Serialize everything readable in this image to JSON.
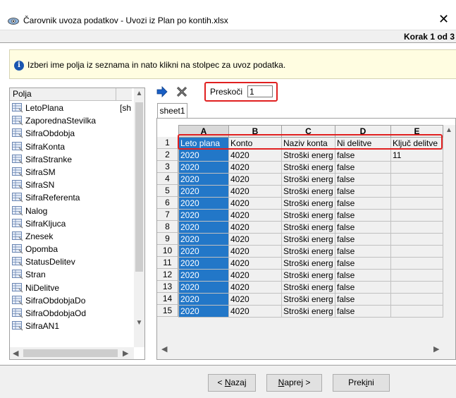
{
  "window": {
    "title": "Čarovnik uvoza podatkov - Uvozi iz Plan po kontih.xlsx",
    "close_glyph": "✕",
    "step_label": "Korak 1 od 3"
  },
  "info": {
    "icon": "info-icon",
    "text": "Izberi ime polja iz seznama in nato klikni na stolpec za uvoz podatka."
  },
  "fields": {
    "header": "Polja",
    "items": [
      {
        "label": "LetoPlana",
        "extra": "[sh"
      },
      {
        "label": "ZaporednaStevilka",
        "extra": ""
      },
      {
        "label": "SifraObdobja",
        "extra": ""
      },
      {
        "label": "SifraKonta",
        "extra": ""
      },
      {
        "label": "SifraStranke",
        "extra": ""
      },
      {
        "label": "SifraSM",
        "extra": ""
      },
      {
        "label": "SifraSN",
        "extra": ""
      },
      {
        "label": "SifraReferenta",
        "extra": ""
      },
      {
        "label": "Nalog",
        "extra": ""
      },
      {
        "label": "SifraKljuca",
        "extra": ""
      },
      {
        "label": "Znesek",
        "extra": ""
      },
      {
        "label": "Opomba",
        "extra": ""
      },
      {
        "label": "StatusDelitev",
        "extra": ""
      },
      {
        "label": "Stran",
        "extra": ""
      },
      {
        "label": "NiDelitve",
        "extra": ""
      },
      {
        "label": "SifraObdobjaDo",
        "extra": ""
      },
      {
        "label": "SifraObdobjaOd",
        "extra": ""
      },
      {
        "label": "SifraAN1",
        "extra": ""
      }
    ]
  },
  "toolbar": {
    "skip_label": "Preskoči",
    "skip_value": "1"
  },
  "sheet": {
    "tab": "sheet1",
    "columns": [
      "A",
      "B",
      "C",
      "D",
      "E"
    ],
    "rows": [
      {
        "n": "1",
        "cells": [
          "Leto plana",
          "Konto",
          "Naziv konta",
          "Ni delitve",
          "Ključ delitve"
        ]
      },
      {
        "n": "2",
        "cells": [
          "2020",
          "4020",
          "Stroški energ",
          "false",
          "11"
        ]
      },
      {
        "n": "3",
        "cells": [
          "2020",
          "4020",
          "Stroški energ",
          "false",
          ""
        ]
      },
      {
        "n": "4",
        "cells": [
          "2020",
          "4020",
          "Stroški energ",
          "false",
          ""
        ]
      },
      {
        "n": "5",
        "cells": [
          "2020",
          "4020",
          "Stroški energ",
          "false",
          ""
        ]
      },
      {
        "n": "6",
        "cells": [
          "2020",
          "4020",
          "Stroški energ",
          "false",
          ""
        ]
      },
      {
        "n": "7",
        "cells": [
          "2020",
          "4020",
          "Stroški energ",
          "false",
          ""
        ]
      },
      {
        "n": "8",
        "cells": [
          "2020",
          "4020",
          "Stroški energ",
          "false",
          ""
        ]
      },
      {
        "n": "9",
        "cells": [
          "2020",
          "4020",
          "Stroški energ",
          "false",
          ""
        ]
      },
      {
        "n": "10",
        "cells": [
          "2020",
          "4020",
          "Stroški energ",
          "false",
          ""
        ]
      },
      {
        "n": "11",
        "cells": [
          "2020",
          "4020",
          "Stroški energ",
          "false",
          ""
        ]
      },
      {
        "n": "12",
        "cells": [
          "2020",
          "4020",
          "Stroški energ",
          "false",
          ""
        ]
      },
      {
        "n": "13",
        "cells": [
          "2020",
          "4020",
          "Stroški energ",
          "false",
          ""
        ]
      },
      {
        "n": "14",
        "cells": [
          "2020",
          "4020",
          "Stroški energ",
          "false",
          ""
        ]
      },
      {
        "n": "15",
        "cells": [
          "2020",
          "4020",
          "Stroški energ",
          "false",
          ""
        ]
      }
    ]
  },
  "buttons": {
    "back": {
      "prefix": "< ",
      "mnemonic": "N",
      "rest": "azaj"
    },
    "next": {
      "prefix": "",
      "mnemonic": "N",
      "rest": "aprej >"
    },
    "cancel": {
      "prefix": "Prek",
      "mnemonic": "i",
      "rest": "ni"
    }
  },
  "colors": {
    "selection": "#2277c8",
    "highlight_border": "#e02020",
    "info_background": "#fffde1"
  }
}
